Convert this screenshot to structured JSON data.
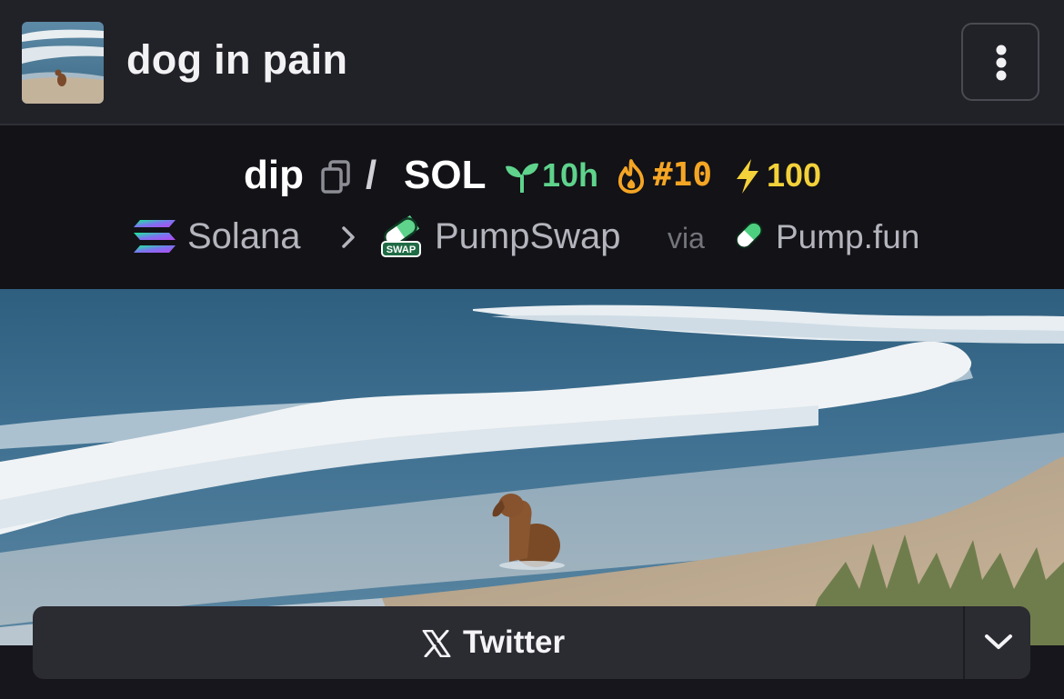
{
  "header": {
    "title": "dog in pain",
    "avatar_icon": "token-avatar",
    "menu_icon": "more-vertical-icon"
  },
  "pair": {
    "base_symbol": "dip",
    "separator": "/",
    "quote_symbol": "SOL",
    "age": "10h",
    "rank": "#10",
    "boost": "100",
    "colors": {
      "age": "#5fd38c",
      "rank": "#f5a524",
      "boost": "#f3d13a"
    }
  },
  "chain": {
    "chain_name": "Solana",
    "dex_name": "PumpSwap",
    "via_label": "via",
    "launchpad_name": "Pump.fun",
    "swap_badge": "SWAP"
  },
  "social": {
    "twitter_label": "Twitter"
  }
}
